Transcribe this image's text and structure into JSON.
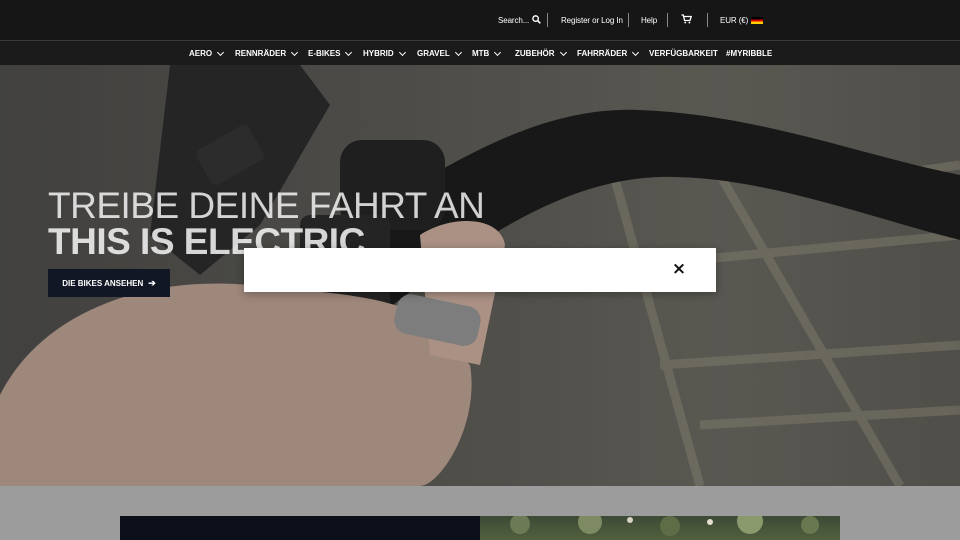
{
  "topbar": {
    "search_label": "Search...",
    "search_icon": "search-icon",
    "account_label": "Register or Log In",
    "help_label": "Help",
    "cart_icon": "cart-icon",
    "currency_label": "EUR (€)",
    "flag_icon": "germany-flag-icon"
  },
  "nav": {
    "items": [
      {
        "label": "AERO",
        "dropdown": true
      },
      {
        "label": "RENNRÄDER",
        "dropdown": true
      },
      {
        "label": "E-BIKES",
        "dropdown": true
      },
      {
        "label": "HYBRID",
        "dropdown": true
      },
      {
        "label": "GRAVEL",
        "dropdown": true
      },
      {
        "label": "MTB",
        "dropdown": true
      },
      {
        "label": "ZUBEHÖR",
        "dropdown": true
      },
      {
        "label": "FAHRRÄDER",
        "dropdown": true
      },
      {
        "label": "VERFÜGBARKEIT",
        "dropdown": false
      },
      {
        "label": "#MYRIBBLE",
        "dropdown": false
      }
    ]
  },
  "hero": {
    "title_line1": "TREIBE DEINE FAHRT AN",
    "title_line2": "THIS IS ELECTRIC",
    "cta_label": "DIE BIKES ANSEHEN",
    "cta_icon": "arrow-right-icon"
  },
  "modal": {
    "close_label": "×",
    "close_icon": "close-icon"
  },
  "colors": {
    "topbar_bg": "#161616",
    "nav_bg": "#1b1b1b",
    "cta_bg": "#111725",
    "section_bg": "#9c9c9c"
  }
}
